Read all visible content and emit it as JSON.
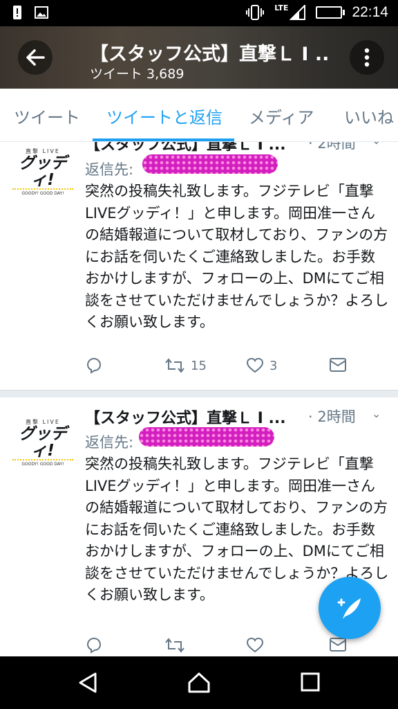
{
  "status_bar": {
    "network": "LTE",
    "time": "22:14"
  },
  "header": {
    "title": "【スタッフ公式】直撃Ｌ I ..",
    "subtitle": "ツイート 3,689"
  },
  "tabs": [
    {
      "label": "ツイート"
    },
    {
      "label": "ツイートと返信"
    },
    {
      "label": "メディア"
    },
    {
      "label": "いいね"
    }
  ],
  "avatar": {
    "top": "直撃 LIVE",
    "logo": "グッディ!",
    "bottom": "GOODY! GOOD DAY!"
  },
  "tweets": [
    {
      "name": "【スタッフ公式】直撃Ｌ I ...",
      "time": "· 2時間",
      "reply_to": "返信先:",
      "text": "突然の投稿失礼致します。フジテレビ「直撃LIVEグッディ！」と申します。岡田准一さんの結婚報道について取材しており、ファンの方にお話を伺いたくご連絡致しました。お手数おかけしますが、フォローの上、DMにてご相談をさせていただけませんでしょうか？よろしくお願い致します。",
      "retweets": "15",
      "likes": "3"
    },
    {
      "name": "【スタッフ公式】直撃Ｌ I ...",
      "time": "· 2時間",
      "reply_to": "返信先:",
      "text": "突然の投稿失礼致します。フジテレビ「直撃LIVEグッディ！」と申します。岡田准一さんの結婚報道について取材しており、ファンの方にお話を伺いたくご連絡致しました。お手数おかけしますが、フォローの上、DMにてご相談をさせていただけませんでしょうか？よろしくお願い致します。",
      "retweets": "",
      "likes": ""
    }
  ],
  "colors": {
    "accent": "#1da1f2",
    "muted": "#657786",
    "redaction": "#d21fc0"
  }
}
